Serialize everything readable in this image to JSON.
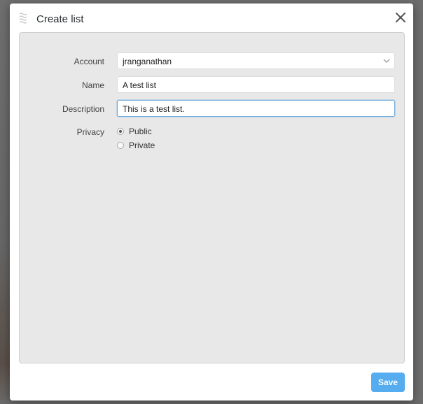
{
  "dialog": {
    "title": "Create list",
    "close_icon": "close-icon",
    "drag_icon": "drag-handle-icon"
  },
  "form": {
    "account": {
      "label": "Account",
      "value": "jranganathan"
    },
    "name": {
      "label": "Name",
      "value": "A test list"
    },
    "description": {
      "label": "Description",
      "value": "This is a test list."
    },
    "privacy": {
      "label": "Privacy",
      "options": [
        {
          "label": "Public",
          "selected": true
        },
        {
          "label": "Private",
          "selected": false
        }
      ]
    }
  },
  "footer": {
    "save_label": "Save"
  },
  "colors": {
    "accent": "#55acee",
    "focus_border": "#6fa8dc",
    "panel_bg": "#e8e8e8"
  }
}
